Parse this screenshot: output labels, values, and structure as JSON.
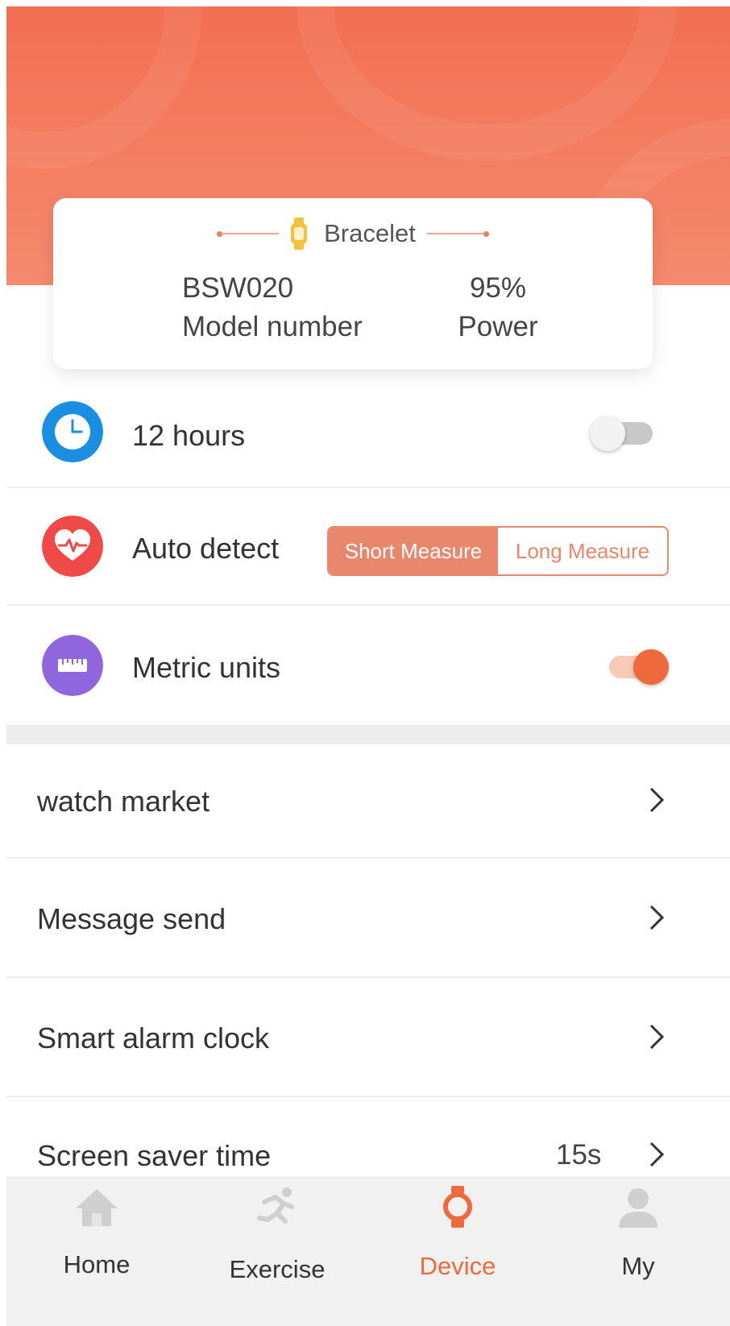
{
  "device_card": {
    "title": "Bracelet",
    "model_value": "BSW020",
    "model_label": "Model number",
    "power_value": "95%",
    "power_label": "Power"
  },
  "settings": {
    "hours": {
      "label": "12 hours",
      "enabled": false
    },
    "auto_detect": {
      "label": "Auto detect",
      "options": [
        "Short Measure",
        "Long Measure"
      ],
      "selected": "Short Measure"
    },
    "metric": {
      "label": "Metric units",
      "enabled": true
    }
  },
  "menu": {
    "watch_market": "watch market",
    "message_send": "Message send",
    "alarm": "Smart alarm clock",
    "screen_saver": {
      "label": "Screen saver time",
      "value": "15s"
    }
  },
  "nav": {
    "items": [
      {
        "label": "Home"
      },
      {
        "label": "Exercise"
      },
      {
        "label": "Device",
        "active": true
      },
      {
        "label": "My"
      }
    ]
  },
  "colors": {
    "header": "#f26f52",
    "accent": "#ee6a3c",
    "segment": "#e9876c",
    "clock_icon": "#1a8fe1",
    "heart_icon": "#ef4a47",
    "ruler_icon": "#8f66de"
  }
}
